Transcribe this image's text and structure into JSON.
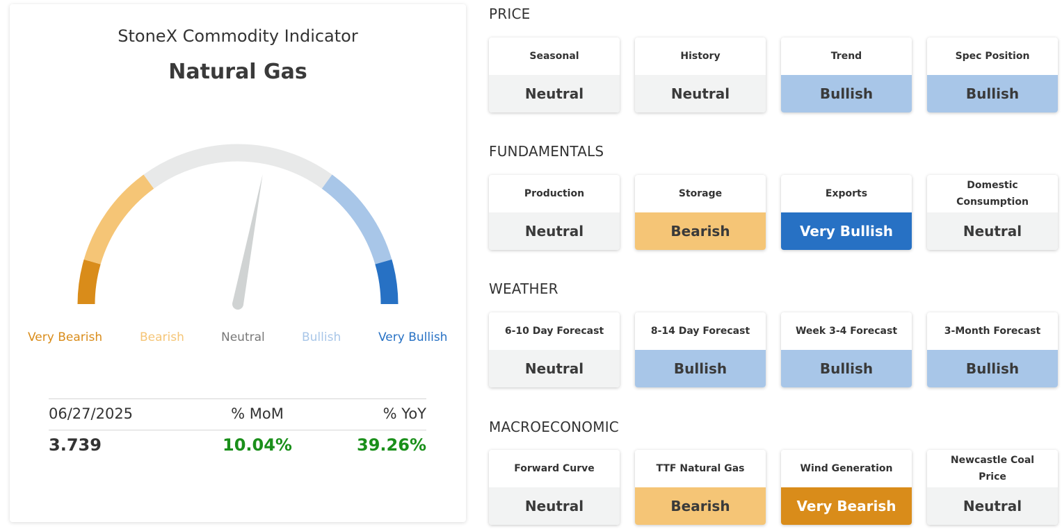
{
  "indicator": {
    "title": "StoneX Commodity Indicator",
    "commodity": "Natural Gas"
  },
  "gauge": {
    "level_fraction": 0.56,
    "labels": [
      {
        "text": "Very Bearish",
        "color": "#d98c1a"
      },
      {
        "text": "Bearish",
        "color": "#f5c576"
      },
      {
        "text": "Neutral",
        "color": "#777777"
      },
      {
        "text": "Bullish",
        "color": "#a8c6e8"
      },
      {
        "text": "Very Bullish",
        "color": "#2771c4"
      }
    ]
  },
  "stats": {
    "date": "06/27/2025",
    "mom_label": "% MoM",
    "yoy_label": "% YoY",
    "price": "3.739",
    "mom_value": "10.04%",
    "yoy_value": "39.26%"
  },
  "colors": {
    "Very Bearish": {
      "bg": "#d98c1a",
      "fg": "#ffffff"
    },
    "Bearish": {
      "bg": "#f5c576",
      "fg": "#3a3a3a"
    },
    "Neutral": {
      "bg": "#f2f3f3",
      "fg": "#3a3a3a"
    },
    "Bullish": {
      "bg": "#a8c6e8",
      "fg": "#3a3a3a"
    },
    "Very Bullish": {
      "bg": "#2771c4",
      "fg": "#ffffff"
    }
  },
  "sections": [
    {
      "title": "PRICE",
      "cards": [
        {
          "label": "Seasonal",
          "value": "Neutral"
        },
        {
          "label": "History",
          "value": "Neutral"
        },
        {
          "label": "Trend",
          "value": "Bullish"
        },
        {
          "label": "Spec Position",
          "value": "Bullish"
        }
      ]
    },
    {
      "title": "FUNDAMENTALS",
      "cards": [
        {
          "label": "Production",
          "value": "Neutral"
        },
        {
          "label": "Storage",
          "value": "Bearish"
        },
        {
          "label": "Exports",
          "value": "Very Bullish"
        },
        {
          "label": "Domestic Consumption",
          "value": "Neutral"
        }
      ]
    },
    {
      "title": "WEATHER",
      "cards": [
        {
          "label": "6-10 Day Forecast",
          "value": "Neutral"
        },
        {
          "label": "8-14 Day Forecast",
          "value": "Bullish"
        },
        {
          "label": "Week 3-4 Forecast",
          "value": "Bullish"
        },
        {
          "label": "3-Month Forecast",
          "value": "Bullish"
        }
      ]
    },
    {
      "title": "MACROECONOMIC",
      "cards": [
        {
          "label": "Forward Curve",
          "value": "Neutral"
        },
        {
          "label": "TTF Natural Gas",
          "value": "Bearish"
        },
        {
          "label": "Wind Generation",
          "value": "Very Bearish"
        },
        {
          "label": "Newcastle Coal Price",
          "value": "Neutral"
        }
      ]
    }
  ]
}
